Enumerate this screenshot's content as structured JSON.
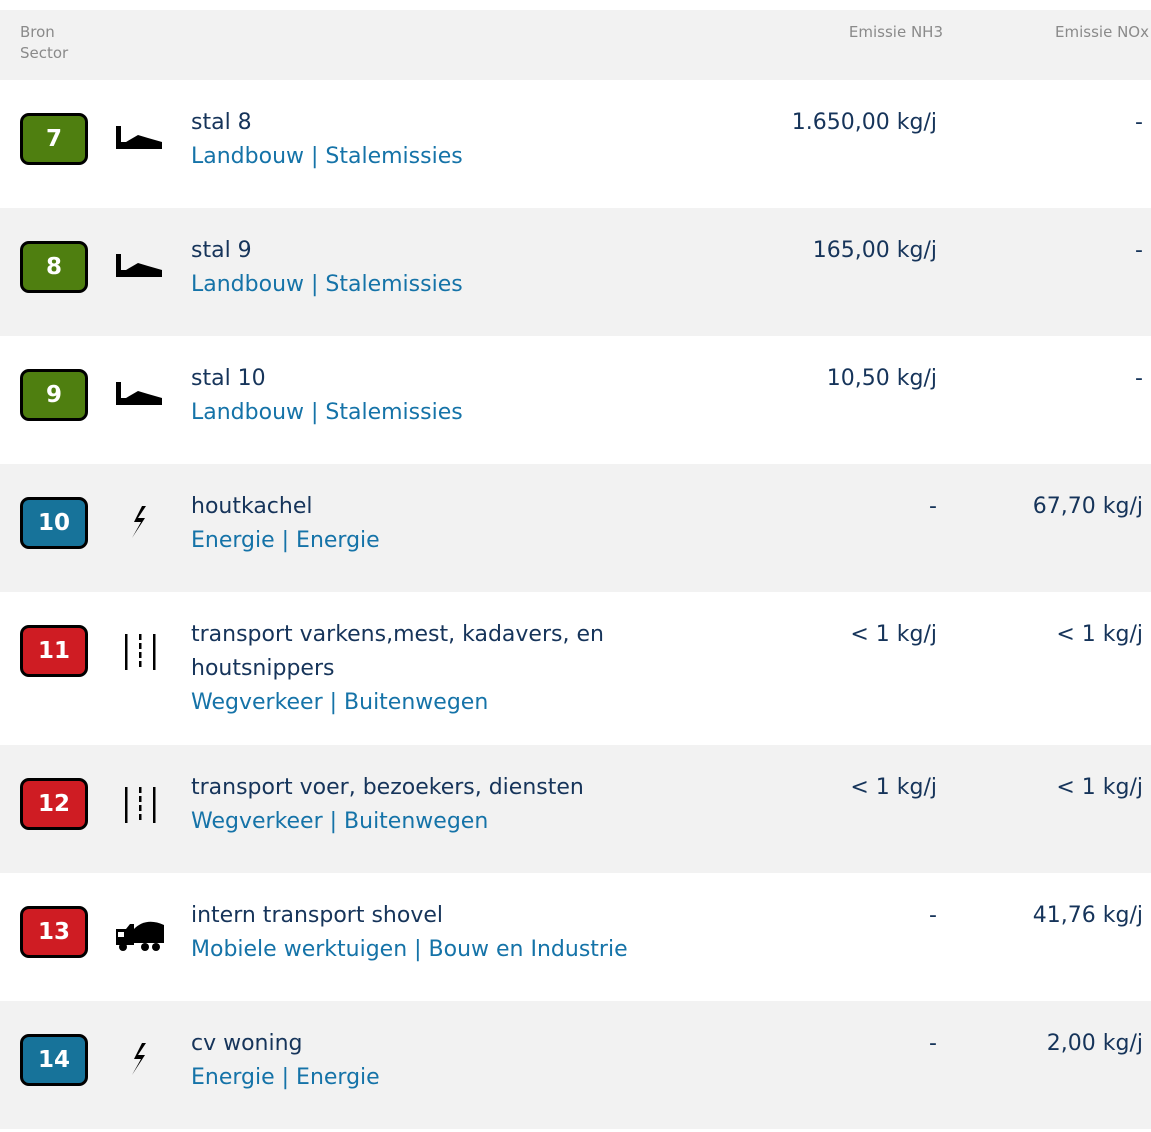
{
  "header": {
    "bron": "Bron",
    "sector": "Sector",
    "nh3": "Emissie NH3",
    "nox": "Emissie NOx"
  },
  "rows": [
    {
      "id": "7",
      "badge_color": "#4f7f10",
      "icon": "barn-icon",
      "name": "stal 8",
      "sector": "Landbouw | Stalemissies",
      "nh3": "1.650,00 kg/j",
      "nox": "-"
    },
    {
      "id": "8",
      "badge_color": "#4f7f10",
      "icon": "barn-icon",
      "name": "stal 9",
      "sector": "Landbouw | Stalemissies",
      "nh3": "165,00 kg/j",
      "nox": "-"
    },
    {
      "id": "9",
      "badge_color": "#4f7f10",
      "icon": "barn-icon",
      "name": "stal 10",
      "sector": "Landbouw | Stalemissies",
      "nh3": "10,50 kg/j",
      "nox": "-"
    },
    {
      "id": "10",
      "badge_color": "#17739a",
      "icon": "lightning-icon",
      "name": "houtkachel",
      "sector": "Energie | Energie",
      "nh3": "-",
      "nox": "67,70 kg/j"
    },
    {
      "id": "11",
      "badge_color": "#cf1c23",
      "icon": "road-icon",
      "name": "transport varkens,mest, kadavers, en houtsnippers",
      "sector": "Wegverkeer | Buitenwegen",
      "nh3": "< 1 kg/j",
      "nox": "< 1 kg/j"
    },
    {
      "id": "12",
      "badge_color": "#cf1c23",
      "icon": "road-icon",
      "name": "transport voer, bezoekers, diensten",
      "sector": "Wegverkeer | Buitenwegen",
      "nh3": "< 1 kg/j",
      "nox": "< 1 kg/j"
    },
    {
      "id": "13",
      "badge_color": "#cf1c23",
      "icon": "mixer-truck-icon",
      "name": "intern transport shovel",
      "sector": "Mobiele werktuigen | Bouw en Industrie",
      "nh3": "-",
      "nox": "41,76 kg/j"
    },
    {
      "id": "14",
      "badge_color": "#17739a",
      "icon": "lightning-icon",
      "name": "cv woning",
      "sector": "Energie | Energie",
      "nh3": "-",
      "nox": "2,00 kg/j"
    }
  ]
}
